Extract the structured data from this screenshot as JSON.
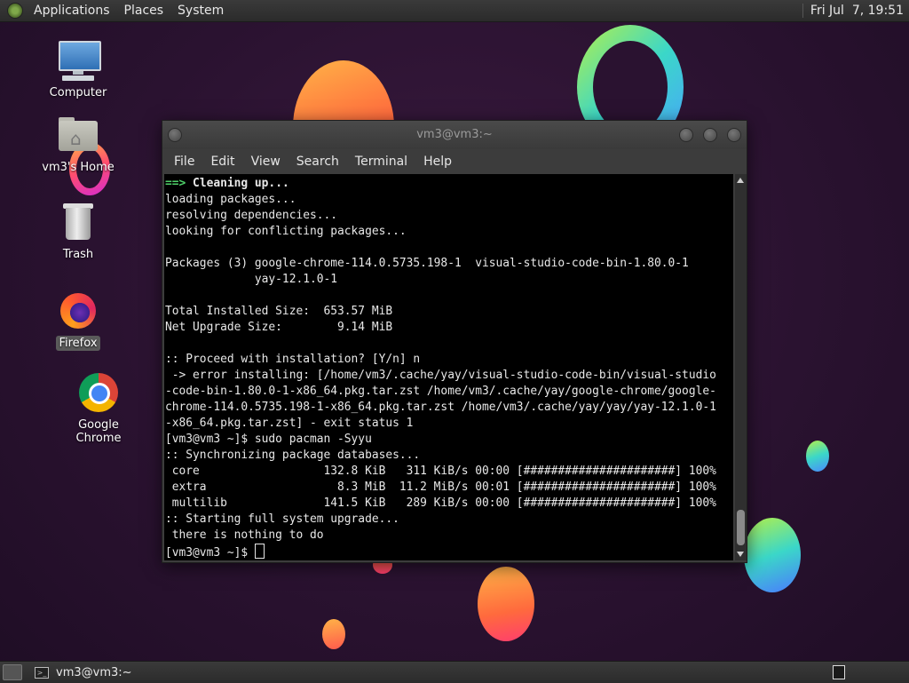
{
  "top_panel": {
    "menus": [
      "Applications",
      "Places",
      "System"
    ],
    "clock": "Fri Jul  7, 19:51"
  },
  "desktop_icons": [
    {
      "label": "Computer"
    },
    {
      "label": "vm3's Home"
    },
    {
      "label": "Trash"
    },
    {
      "label": "Firefox"
    },
    {
      "label": "Google Chrome"
    }
  ],
  "terminal": {
    "title": "vm3@vm3:~",
    "menu": [
      "File",
      "Edit",
      "View",
      "Search",
      "Terminal",
      "Help"
    ],
    "lines": [
      "==> Cleaning up...",
      "loading packages...",
      "resolving dependencies...",
      "looking for conflicting packages...",
      "",
      "Packages (3) google-chrome-114.0.5735.198-1  visual-studio-code-bin-1.80.0-1",
      "             yay-12.1.0-1",
      "",
      "Total Installed Size:  653.57 MiB",
      "Net Upgrade Size:        9.14 MiB",
      "",
      ":: Proceed with installation? [Y/n] n",
      " -> error installing: [/home/vm3/.cache/yay/visual-studio-code-bin/visual-studio",
      "-code-bin-1.80.0-1-x86_64.pkg.tar.zst /home/vm3/.cache/yay/google-chrome/google-",
      "chrome-114.0.5735.198-1-x86_64.pkg.tar.zst /home/vm3/.cache/yay/yay/yay-12.1.0-1",
      "-x86_64.pkg.tar.zst] - exit status 1",
      "[vm3@vm3 ~]$ sudo pacman -Syyu",
      ":: Synchronizing package databases...",
      " core                  132.8 KiB   311 KiB/s 00:00 [######################] 100%",
      " extra                   8.3 MiB  11.2 MiB/s 00:01 [######################] 100%",
      " multilib              141.5 KiB   289 KiB/s 00:00 [######################] 100%",
      ":: Starting full system upgrade...",
      " there is nothing to do",
      "[vm3@vm3 ~]$ "
    ]
  },
  "bottom_panel": {
    "task_label": "vm3@vm3:~"
  },
  "colors": {
    "prompt_arrow": "#4fd26a",
    "terminal_bg": "#000000",
    "panel_bg": "#2f2f2f"
  }
}
